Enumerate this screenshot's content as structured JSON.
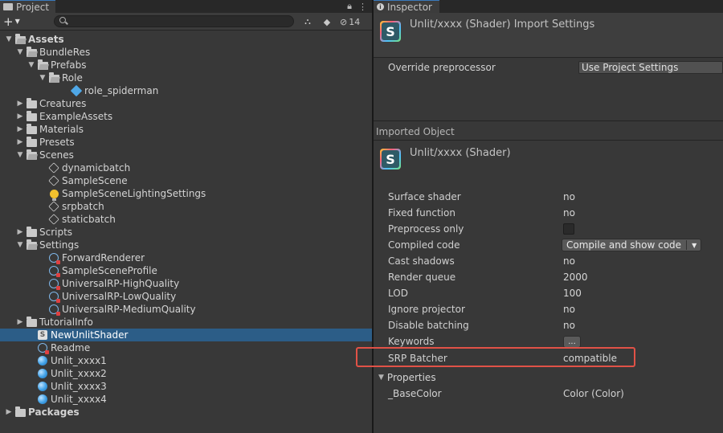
{
  "project": {
    "tab_label": "Project",
    "hidden_count": "14",
    "tree": [
      {
        "label": "Assets",
        "depth": 0,
        "arrow": "down",
        "icon": "folder-open",
        "bold": true
      },
      {
        "label": "BundleRes",
        "depth": 1,
        "arrow": "down",
        "icon": "folder-open"
      },
      {
        "label": "Prefabs",
        "depth": 2,
        "arrow": "down",
        "icon": "folder-open"
      },
      {
        "label": "Role",
        "depth": 3,
        "arrow": "down",
        "icon": "folder-open"
      },
      {
        "label": "role_spiderman",
        "depth": 5,
        "arrow": "none",
        "icon": "prefab-cube"
      },
      {
        "label": "Creatures",
        "depth": 1,
        "arrow": "right",
        "icon": "folder"
      },
      {
        "label": "ExampleAssets",
        "depth": 1,
        "arrow": "right",
        "icon": "folder"
      },
      {
        "label": "Materials",
        "depth": 1,
        "arrow": "right",
        "icon": "folder"
      },
      {
        "label": "Presets",
        "depth": 1,
        "arrow": "right",
        "icon": "folder"
      },
      {
        "label": "Scenes",
        "depth": 1,
        "arrow": "down",
        "icon": "folder-open"
      },
      {
        "label": "dynamicbatch",
        "depth": 3,
        "arrow": "none",
        "icon": "unity-scene"
      },
      {
        "label": "SampleScene",
        "depth": 3,
        "arrow": "none",
        "icon": "unity-scene"
      },
      {
        "label": "SampleSceneLightingSettings",
        "depth": 3,
        "arrow": "none",
        "icon": "lightbulb"
      },
      {
        "label": "srpbatch",
        "depth": 3,
        "arrow": "none",
        "icon": "unity-scene"
      },
      {
        "label": "staticbatch",
        "depth": 3,
        "arrow": "none",
        "icon": "unity-scene"
      },
      {
        "label": "Scripts",
        "depth": 1,
        "arrow": "right",
        "icon": "folder"
      },
      {
        "label": "Settings",
        "depth": 1,
        "arrow": "down",
        "icon": "folder-open"
      },
      {
        "label": "ForwardRenderer",
        "depth": 3,
        "arrow": "none",
        "icon": "scriptable-asset"
      },
      {
        "label": "SampleSceneProfile",
        "depth": 3,
        "arrow": "none",
        "icon": "scriptable-asset"
      },
      {
        "label": "UniversalRP-HighQuality",
        "depth": 3,
        "arrow": "none",
        "icon": "scriptable-asset"
      },
      {
        "label": "UniversalRP-LowQuality",
        "depth": 3,
        "arrow": "none",
        "icon": "scriptable-asset"
      },
      {
        "label": "UniversalRP-MediumQuality",
        "depth": 3,
        "arrow": "none",
        "icon": "scriptable-asset"
      },
      {
        "label": "TutorialInfo",
        "depth": 1,
        "arrow": "right",
        "icon": "folder"
      },
      {
        "label": "NewUnlitShader",
        "depth": 2,
        "arrow": "none",
        "icon": "shader-file",
        "selected": true
      },
      {
        "label": "Readme",
        "depth": 2,
        "arrow": "none",
        "icon": "scriptable-asset"
      },
      {
        "label": "Unlit_xxxx1",
        "depth": 2,
        "arrow": "none",
        "icon": "material-sphere"
      },
      {
        "label": "Unlit_xxxx2",
        "depth": 2,
        "arrow": "none",
        "icon": "material-sphere"
      },
      {
        "label": "Unlit_xxxx3",
        "depth": 2,
        "arrow": "none",
        "icon": "material-sphere"
      },
      {
        "label": "Unlit_xxxx4",
        "depth": 2,
        "arrow": "none",
        "icon": "material-sphere"
      },
      {
        "label": "Packages",
        "depth": 0,
        "arrow": "right",
        "icon": "folder",
        "bold": true
      }
    ]
  },
  "inspector": {
    "tab_label": "Inspector",
    "header_title": "Unlit/xxxx (Shader) Import Settings",
    "override_label": "Override preprocessor",
    "override_value": "Use Project Settings",
    "imported_object_label": "Imported Object",
    "object_title": "Unlit/xxxx (Shader)",
    "properties": {
      "surface_shader": {
        "label": "Surface shader",
        "value": "no"
      },
      "fixed_function": {
        "label": "Fixed function",
        "value": "no"
      },
      "preprocess_only": {
        "label": "Preprocess only"
      },
      "compiled_code": {
        "label": "Compiled code",
        "value": "Compile and show code"
      },
      "cast_shadows": {
        "label": "Cast shadows",
        "value": "no"
      },
      "render_queue": {
        "label": "Render queue",
        "value": "2000"
      },
      "lod": {
        "label": "LOD",
        "value": "100"
      },
      "ignore_projector": {
        "label": "Ignore projector",
        "value": "no"
      },
      "disable_batching": {
        "label": "Disable batching",
        "value": "no"
      },
      "keywords": {
        "label": "Keywords",
        "value": "..."
      },
      "srp_batcher": {
        "label": "SRP Batcher",
        "value": "compatible"
      }
    },
    "properties_foldout": "Properties",
    "base_color": {
      "label": "_BaseColor",
      "value": "Color (Color)"
    }
  },
  "colors": {
    "selection": "#2c5d87",
    "highlight_box": "#e15247",
    "tab_accent": "#3a79bb"
  }
}
